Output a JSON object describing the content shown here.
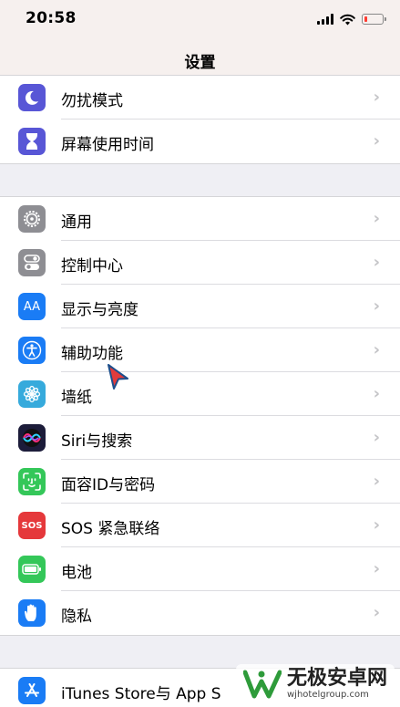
{
  "status_bar": {
    "time": "20:58",
    "battery_level": 0.15
  },
  "nav": {
    "title": "设置"
  },
  "groups": [
    {
      "items": [
        {
          "label": "勿扰模式",
          "icon": "moon-icon",
          "color": "#5856d6"
        },
        {
          "label": "屏幕使用时间",
          "icon": "hourglass-icon",
          "color": "#5856d6"
        }
      ]
    },
    {
      "items": [
        {
          "label": "通用",
          "icon": "gear-icon",
          "color": "#8e8e93"
        },
        {
          "label": "控制中心",
          "icon": "toggles-icon",
          "color": "#8e8e93"
        },
        {
          "label": "显示与亮度",
          "icon": "text-size-icon",
          "color": "#1a7cf5"
        },
        {
          "label": "辅助功能",
          "icon": "accessibility-icon",
          "color": "#1a7cf5"
        },
        {
          "label": "墙纸",
          "icon": "flower-icon",
          "color": "#36aadc"
        },
        {
          "label": "Siri与搜索",
          "icon": "siri-icon",
          "color": "#1c1c3a"
        },
        {
          "label": "面容ID与密码",
          "icon": "face-id-icon",
          "color": "#34c759"
        },
        {
          "label": "SOS 紧急联络",
          "icon": "sos-icon",
          "color": "#e5383b"
        },
        {
          "label": "电池",
          "icon": "battery-icon",
          "color": "#34c759"
        },
        {
          "label": "隐私",
          "icon": "hand-icon",
          "color": "#1a7cf5"
        }
      ]
    },
    {
      "items": [
        {
          "label": "iTunes Store与 App S",
          "icon": "app-store-icon",
          "color": "#1a7cf5"
        }
      ]
    }
  ],
  "icon_text": {
    "text_size": "AA",
    "sos": "SOS"
  },
  "watermark": {
    "name": "无极安卓网",
    "url": "wjhotelgroup.com"
  }
}
